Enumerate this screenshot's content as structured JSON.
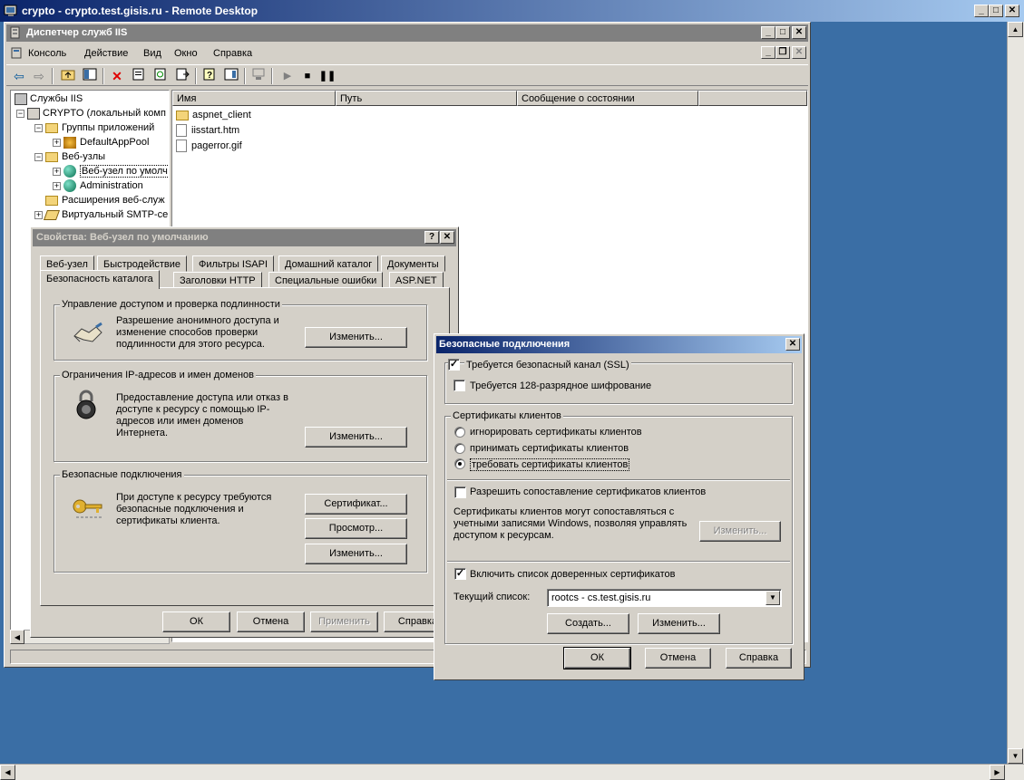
{
  "rdp": {
    "title": "crypto - crypto.test.gisis.ru - Remote Desktop"
  },
  "iis": {
    "title": "Диспетчер служб IIS",
    "menu": [
      "Консоль",
      "Действие",
      "Вид",
      "Окно",
      "Справка"
    ],
    "tree": {
      "root": "Службы IIS",
      "server": "CRYPTO (локальный комп",
      "app_groups": "Группы приложений",
      "default_pool": "DefaultAppPool",
      "websites": "Веб-узлы",
      "default_site": "Веб-узел по умолч",
      "administration": "Administration",
      "extensions": "Расширения веб-служ",
      "smtp": "Виртуальный SMTP-се"
    },
    "list": {
      "columns": [
        "Имя",
        "Путь",
        "Сообщение о состоянии"
      ],
      "rows": [
        "aspnet_client",
        "iisstart.htm",
        "pagerror.gif"
      ]
    }
  },
  "props": {
    "title": "Свойства: Веб-узел по умолчанию",
    "tabs_row1": [
      "Веб-узел",
      "Быстродействие",
      "Фильтры ISAPI",
      "Домашний каталог",
      "Документы"
    ],
    "tabs_row2": [
      "Безопасность каталога",
      "Заголовки HTTP",
      "Специальные ошибки",
      "ASP.NET"
    ],
    "auth": {
      "label": "Управление доступом и проверка подлинности",
      "text": "Разрешение анонимного доступа и изменение способов проверки подлинности для этого ресурса.",
      "edit": "Изменить..."
    },
    "ip": {
      "label": "Ограничения IP-адресов и имен доменов",
      "text": "Предоставление доступа или отказ в доступе к ресурсу с помощью IP-адресов или имен доменов Интернета.",
      "edit": "Изменить..."
    },
    "secure": {
      "label": "Безопасные подключения",
      "text": "При доступе к ресурсу требуются безопасные подключения и сертификаты клиента.",
      "cert": "Сертификат...",
      "view": "Просмотр...",
      "edit": "Изменить..."
    },
    "buttons": {
      "ok": "ОК",
      "cancel": "Отмена",
      "apply": "Применить",
      "help": "Справка"
    }
  },
  "ssl": {
    "title": "Безопасные подключения",
    "require_ssl": "Требуется безопасный канал (SSL)",
    "require_128": "Требуется 128-разрядное шифрование",
    "client_certs_label": "Сертификаты клиентов",
    "ignore": "игнорировать сертификаты клиентов",
    "accept": "принимать сертификаты клиентов",
    "require": "требовать сертификаты клиентов",
    "mapping": "Разрешить сопоставление сертификатов клиентов",
    "mapping_text": "Сертификаты клиентов могут сопоставляться с учетными записями Windows, позволяя управлять доступом к ресурсам.",
    "mapping_edit": "Изменить...",
    "trust_list": "Включить список доверенных сертификатов",
    "current_list_label": "Текущий список:",
    "current_list_value": "rootcs -  cs.test.gisis.ru",
    "create": "Создать...",
    "edit": "Изменить...",
    "ok": "ОК",
    "cancel": "Отмена",
    "help": "Справка"
  }
}
